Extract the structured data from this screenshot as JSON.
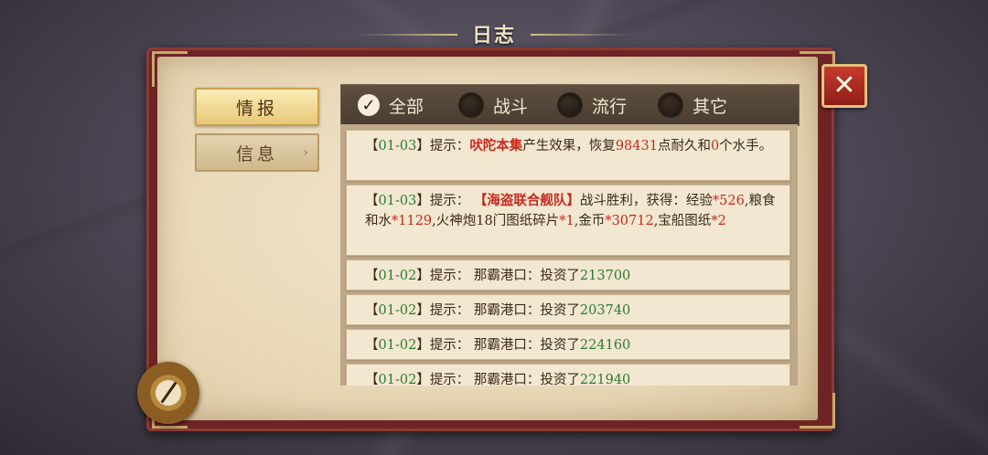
{
  "title": "日志",
  "close_icon": "close-x-icon",
  "side_tabs": [
    {
      "label": "情报",
      "active": true
    },
    {
      "label": "信息",
      "active": false,
      "arrow": "›"
    }
  ],
  "filters": [
    {
      "label": "全部",
      "checked": true,
      "check_mark": "✓"
    },
    {
      "label": "战斗",
      "checked": false
    },
    {
      "label": "流行",
      "checked": false
    },
    {
      "label": "其它",
      "checked": false
    }
  ],
  "entries": [
    {
      "date": "01-03",
      "prefix": "提示：",
      "highlight": "吠陀本集",
      "text1": "产生效果，恢复",
      "num1": "98431",
      "text2": "点耐久和",
      "num2": "0",
      "text3": "个水手。"
    },
    {
      "date": "01-03",
      "prefix": "提示：",
      "highlight": "【海盗联合舰队】",
      "text1": "战斗胜利，获得：经验",
      "val1": "*526",
      "text2": ",粮食和水",
      "val2": "*1129",
      "text3": ",火神炮18门图纸碎片",
      "val3": "*1",
      "text4": ",金币",
      "val4": "*30712",
      "text5": ",宝船图纸",
      "val5": "*2"
    },
    {
      "date": "01-02",
      "text": "提示： 那霸港口：投资了",
      "amount": "213700"
    },
    {
      "date": "01-02",
      "text": "提示： 那霸港口：投资了",
      "amount": "203740"
    },
    {
      "date": "01-02",
      "text": "提示： 那霸港口：投资了",
      "amount": "224160"
    },
    {
      "date": "01-02",
      "text": "提示： 那霸港口：投资了",
      "amount": "221940"
    }
  ],
  "colors": {
    "date": "#2c7a32",
    "highlight": "#c62a1e",
    "amount": "#2c7a32",
    "book_cover": "#6e2424",
    "page": "#f1e6cf"
  },
  "decor_icon": "compass-icon"
}
